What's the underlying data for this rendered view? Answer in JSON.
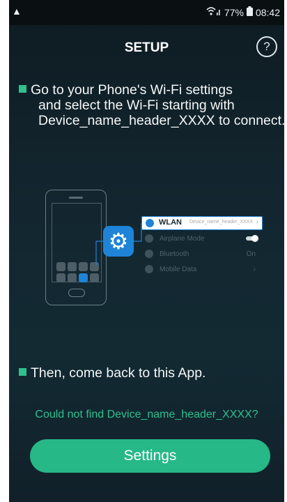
{
  "status_bar": {
    "warning_icon": "warning-triangle-icon",
    "signal_icons": "wifi-signal-icons",
    "battery_percent": "77%",
    "time": "08:42"
  },
  "header": {
    "title": "SETUP",
    "help_icon": "help-circle-icon"
  },
  "instruction": {
    "line1": "Go to your Phone's Wi-Fi settings",
    "line2": "and select the Wi-Fi starting with",
    "line3": "Device_name_header_XXXX to connect."
  },
  "illustration": {
    "wlan_label": "WLAN",
    "wlan_value": "Device_name_header_XXXX",
    "rows": [
      {
        "label": "Airplane Mode",
        "value": ""
      },
      {
        "label": "Bluetooth",
        "value": "On"
      },
      {
        "label": "Mobile Data",
        "value": ""
      }
    ]
  },
  "then_text": "Then, come back to this App.",
  "help_link": "Could not find Device_name_header_XXXX?",
  "settings_button": "Settings",
  "colors": {
    "accent": "#26b887",
    "background": "#13262f",
    "wlan_blue": "#1f84d8"
  }
}
